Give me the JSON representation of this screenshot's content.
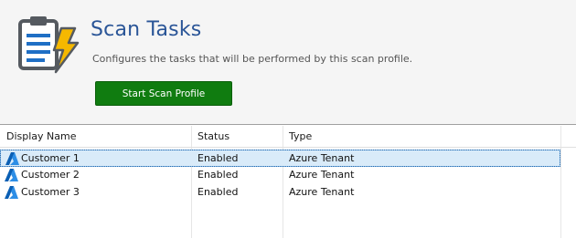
{
  "header": {
    "icon": "clipboard-lightning-icon",
    "title": "Scan Tasks",
    "subtitle": "Configures the tasks that will be performed by this scan profile.",
    "start_button_label": "Start Scan Profile"
  },
  "colors": {
    "title": "#2a5597",
    "button": "#107c10",
    "selection": "#d9ebf9",
    "icon_blue": "#0078d4",
    "icon_yellow": "#f5b800"
  },
  "table": {
    "columns": [
      "Display Name",
      "Status",
      "Type"
    ],
    "rows": [
      {
        "icon": "azure-icon",
        "name": "Customer 1",
        "status": "Enabled",
        "type": "Azure Tenant",
        "selected": true
      },
      {
        "icon": "azure-icon",
        "name": "Customer 2",
        "status": "Enabled",
        "type": "Azure Tenant",
        "selected": false
      },
      {
        "icon": "azure-icon",
        "name": "Customer 3",
        "status": "Enabled",
        "type": "Azure Tenant",
        "selected": false
      }
    ]
  }
}
